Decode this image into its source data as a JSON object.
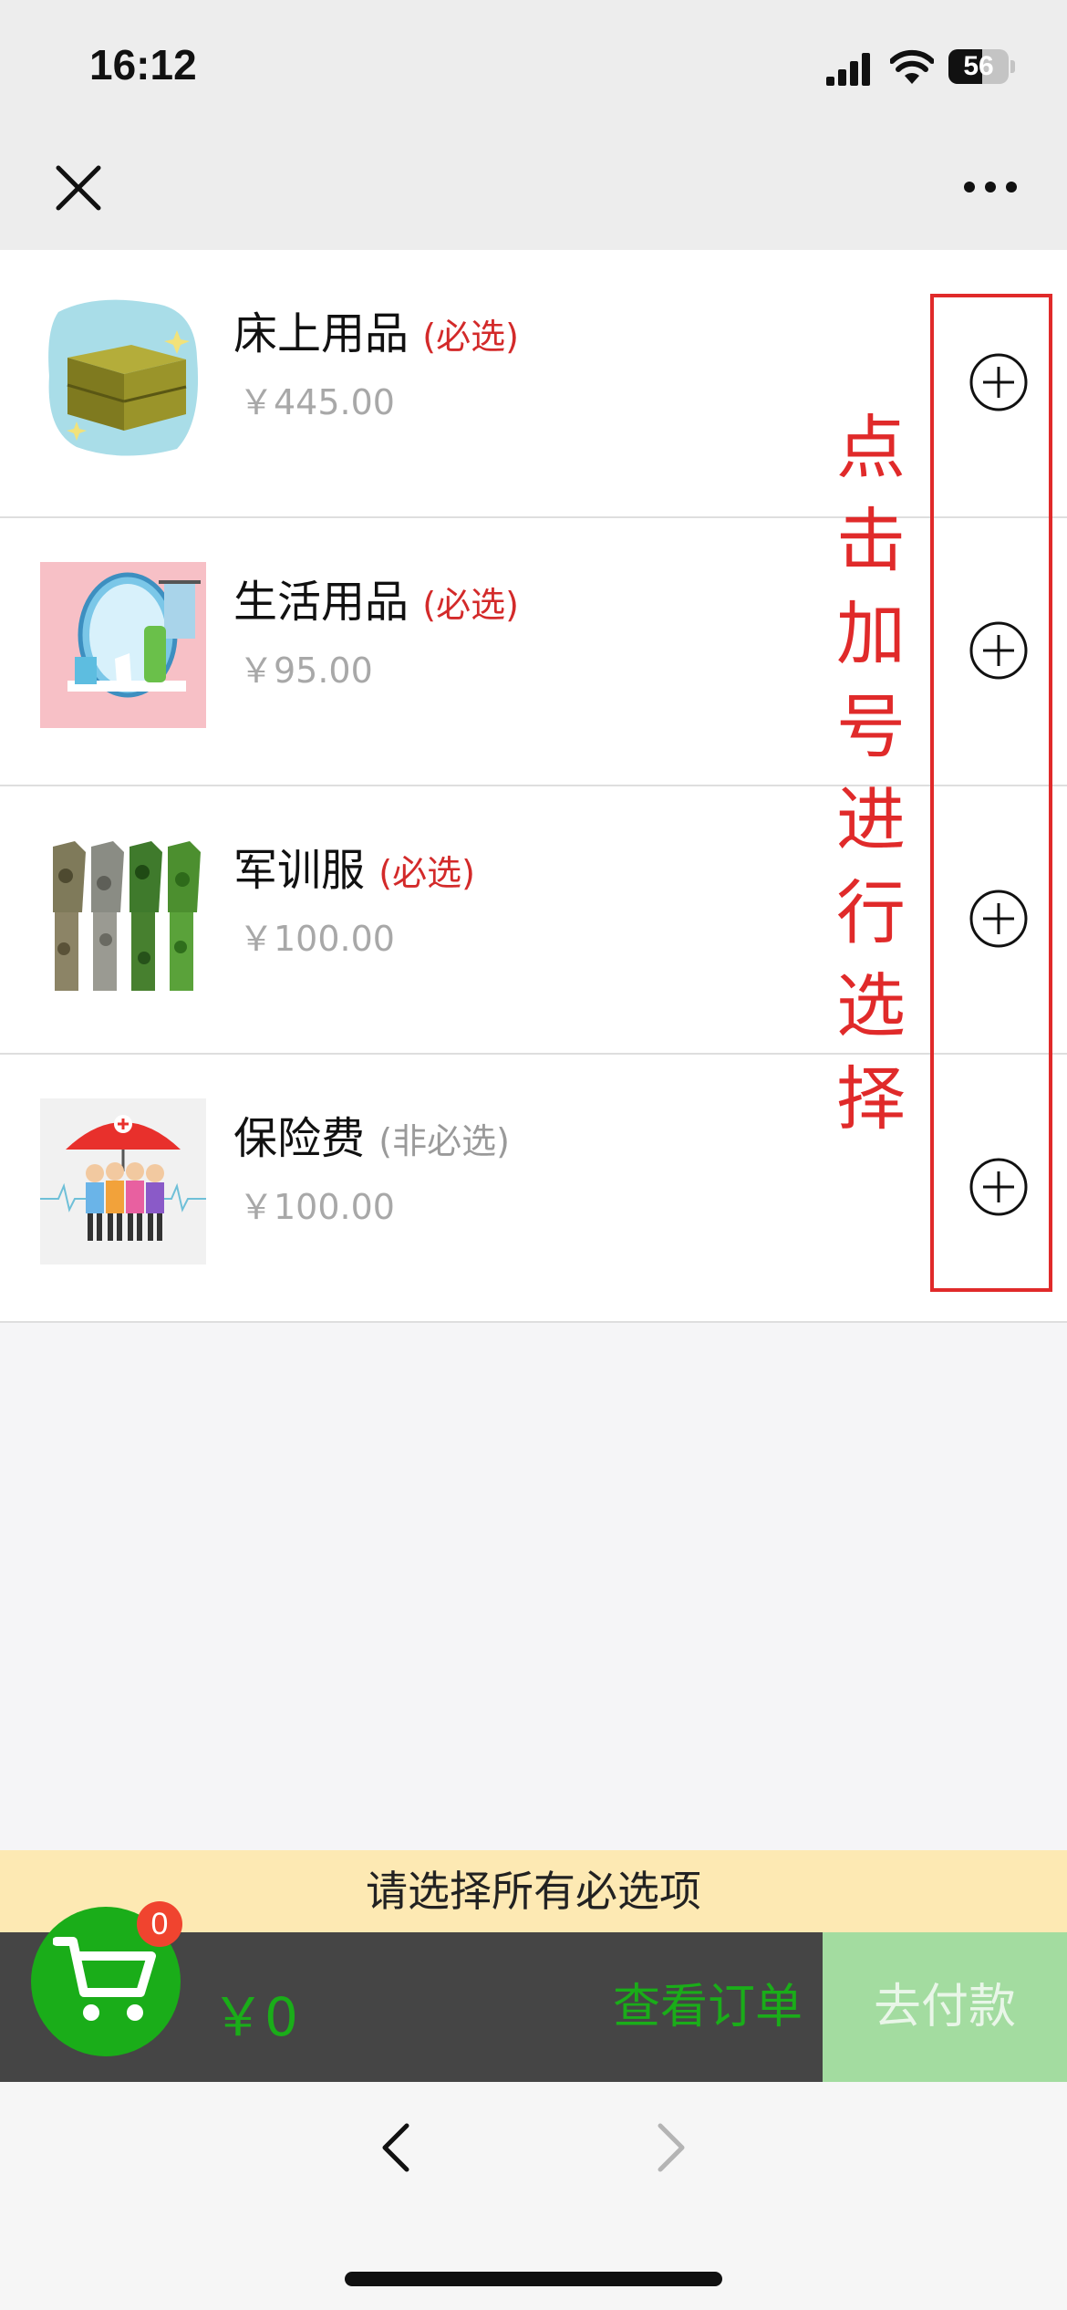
{
  "status_bar": {
    "time": "16:12",
    "battery": "56",
    "battery_level": 0.56
  },
  "nav": {
    "close_icon": "close-icon",
    "more_icon": "more-icon"
  },
  "items": [
    {
      "name": "床上用品",
      "tag": "(必选)",
      "required": true,
      "price": "￥445.00",
      "image": "bedding-box"
    },
    {
      "name": "生活用品",
      "tag": "(必选)",
      "required": true,
      "price": "￥95.00",
      "image": "toiletries"
    },
    {
      "name": "军训服",
      "tag": "(必选)",
      "required": true,
      "price": "￥100.00",
      "image": "camouflage-uniforms"
    },
    {
      "name": "保险费",
      "tag": "(非必选)",
      "required": false,
      "price": "￥100.00",
      "image": "insurance-umbrella"
    }
  ],
  "annotation": {
    "text": "点击加号进行选择"
  },
  "notice": "请选择所有必选项",
  "cart": {
    "count": "0",
    "total": "￥0",
    "view_order_label": "查看订单",
    "pay_label": "去付款"
  },
  "colors": {
    "accent_green": "#1aad19",
    "required_red": "#d32a2a",
    "annotation_red": "#e02a2a",
    "notice_bg": "#fde9b3",
    "cart_bar_bg": "#454545",
    "pay_disabled_bg": "#a3dca0"
  }
}
